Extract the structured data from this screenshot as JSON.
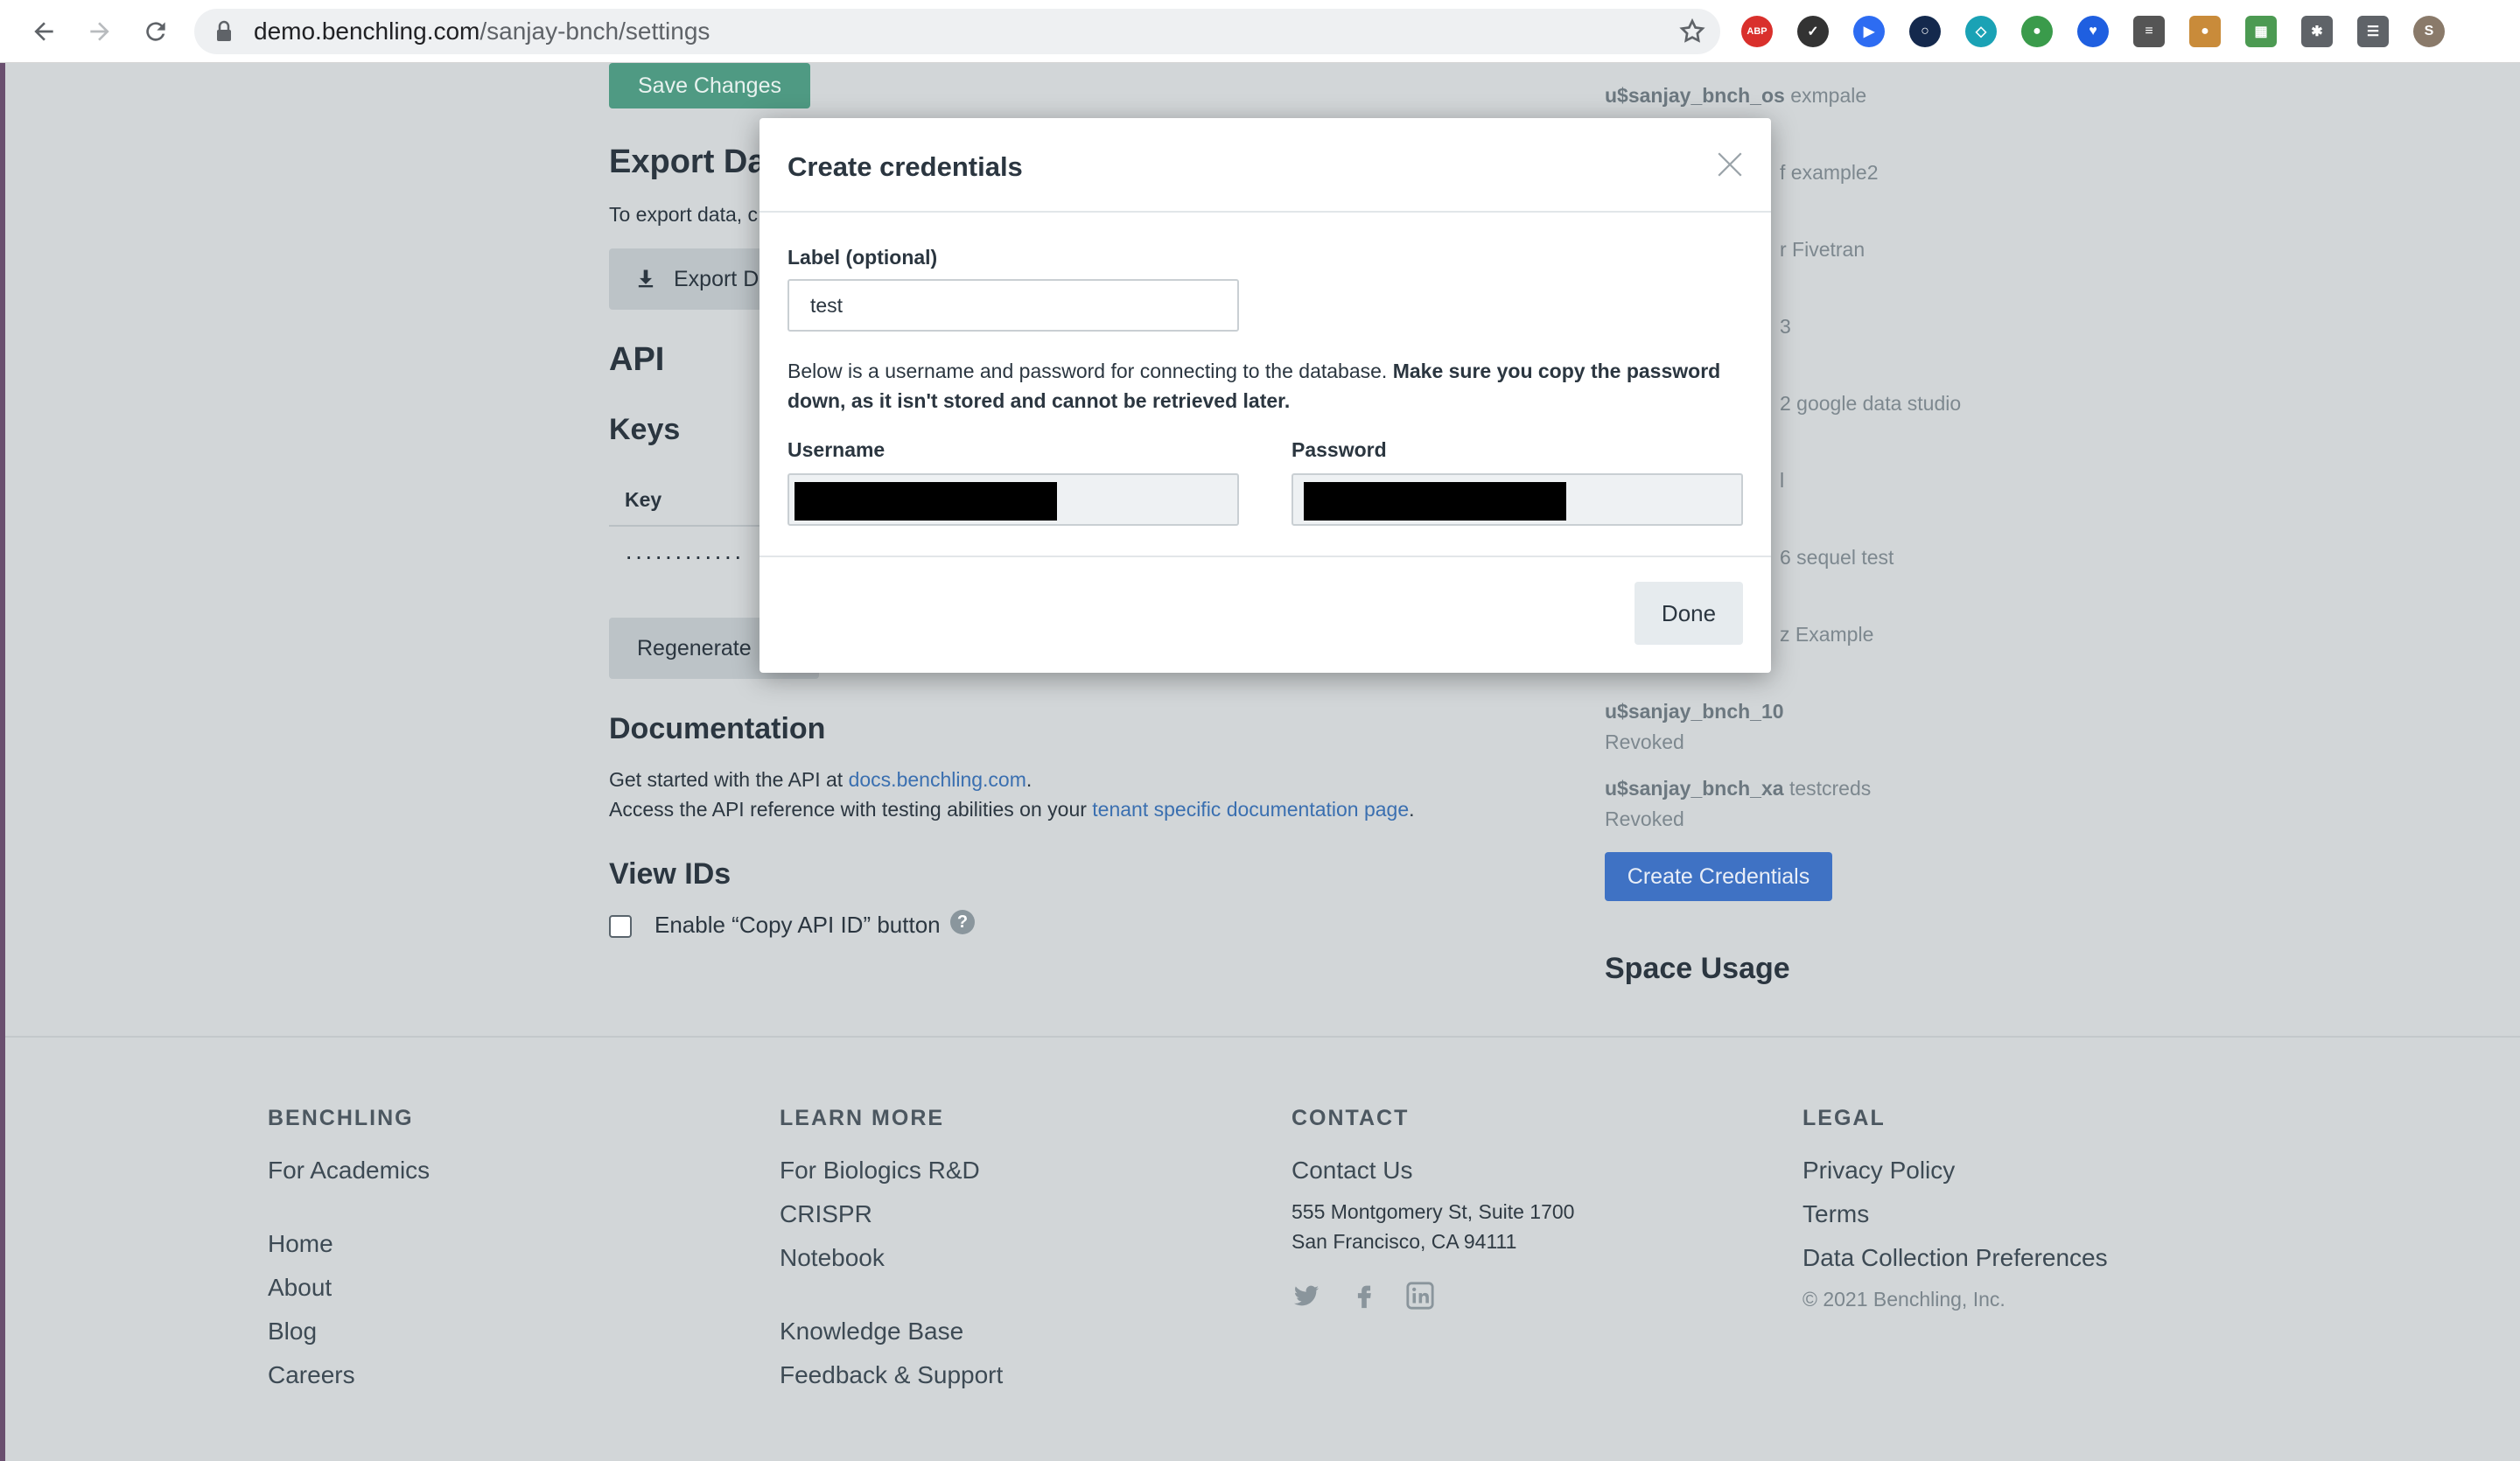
{
  "browser": {
    "url_host": "demo.benchling.com",
    "url_path": "/sanjay-bnch/settings",
    "extensions": [
      {
        "name": "adblock-icon",
        "label": "ABP",
        "color": "#d9302c"
      },
      {
        "name": "check-circle-icon",
        "label": "✓",
        "color": "#333333"
      },
      {
        "name": "zoom-icon",
        "label": "▶",
        "color": "#2d6cf2"
      },
      {
        "name": "ring-icon",
        "label": "○",
        "color": "#14294d"
      },
      {
        "name": "cube-icon",
        "label": "◇",
        "color": "#1aa2b5"
      },
      {
        "name": "leaf-icon",
        "label": "●",
        "color": "#3a9b4b"
      },
      {
        "name": "shield-icon",
        "label": "♥",
        "color": "#1f5fe0"
      },
      {
        "name": "reader-icon",
        "label": "≡",
        "color": "#555555"
      },
      {
        "name": "cookie-icon",
        "label": "●",
        "color": "#c98b3a"
      },
      {
        "name": "sheet-icon",
        "label": "▦",
        "color": "#4c9a52"
      },
      {
        "name": "puzzle-icon",
        "label": "✱",
        "color": "#5f6368"
      },
      {
        "name": "media-icon",
        "label": "☰",
        "color": "#5f6368"
      }
    ]
  },
  "settings": {
    "save_button": "Save Changes",
    "export_title": "Export Da",
    "export_text": "To export data, c",
    "export_button": "Export D",
    "api_title": "API",
    "keys_title": "Keys",
    "keys_col_header": "Key",
    "key_masked": "············",
    "regenerate_button": "Regenerate",
    "documentation_title": "Documentation",
    "doc_line1_prefix": "Get started with the API at ",
    "doc_line1_link": "docs.benchling.com",
    "doc_line1_suffix": ".",
    "doc_line2_prefix": "Access the API reference with testing abilities on your ",
    "doc_line2_link": "tenant specific documentation page",
    "doc_line2_suffix": ".",
    "view_ids_title": "View IDs",
    "copy_api_id_label": "Enable “Copy API ID” button",
    "copy_api_id_checked": false
  },
  "credentials": {
    "items": [
      {
        "user": "u$sanjay_bnch_os",
        "label": "exmpale",
        "status": ""
      },
      {
        "user": "",
        "label": "f example2",
        "status": ""
      },
      {
        "user": "",
        "label": "r Fivetran",
        "status": ""
      },
      {
        "user": "",
        "label": "3",
        "status": ""
      },
      {
        "user": "",
        "label": "2 google data studio",
        "status": ""
      },
      {
        "user": "",
        "label": "l",
        "status": ""
      },
      {
        "user": "",
        "label": "6 sequel test",
        "status": ""
      },
      {
        "user": "",
        "label": "z Example",
        "status": ""
      },
      {
        "user": "u$sanjay_bnch_10",
        "label": "",
        "status": "Revoked"
      },
      {
        "user": "u$sanjay_bnch_xa",
        "label": "testcreds",
        "status": "Revoked"
      }
    ],
    "create_button": "Create Credentials",
    "space_usage_title": "Space Usage"
  },
  "modal": {
    "title": "Create credentials",
    "label_field_label": "Label (optional)",
    "label_field_value": "test",
    "description_plain": "Below is a username and password for connecting to the database. ",
    "description_bold": "Make sure you copy the password down, as it isn't stored and cannot be retrieved later.",
    "username_label": "Username",
    "password_label": "Password",
    "done_button": "Done"
  },
  "footer": {
    "benchling": {
      "heading": "BENCHLING",
      "links": [
        "For Academics",
        "Home",
        "About",
        "Blog",
        "Careers"
      ]
    },
    "learn_more": {
      "heading": "LEARN MORE",
      "links": [
        "For Biologics R&D",
        "CRISPR",
        "Notebook",
        "Knowledge Base",
        "Feedback & Support"
      ]
    },
    "contact": {
      "heading": "CONTACT",
      "link": "Contact Us",
      "address_line1": "555 Montgomery St, Suite 1700",
      "address_line2": "San Francisco, CA 94111",
      "social": [
        "twitter-icon",
        "facebook-icon",
        "linkedin-icon"
      ]
    },
    "legal": {
      "heading": "LEGAL",
      "links": [
        "Privacy Policy",
        "Terms",
        "Data Collection Preferences"
      ],
      "copyright": "© 2021 Benchling, Inc."
    }
  }
}
